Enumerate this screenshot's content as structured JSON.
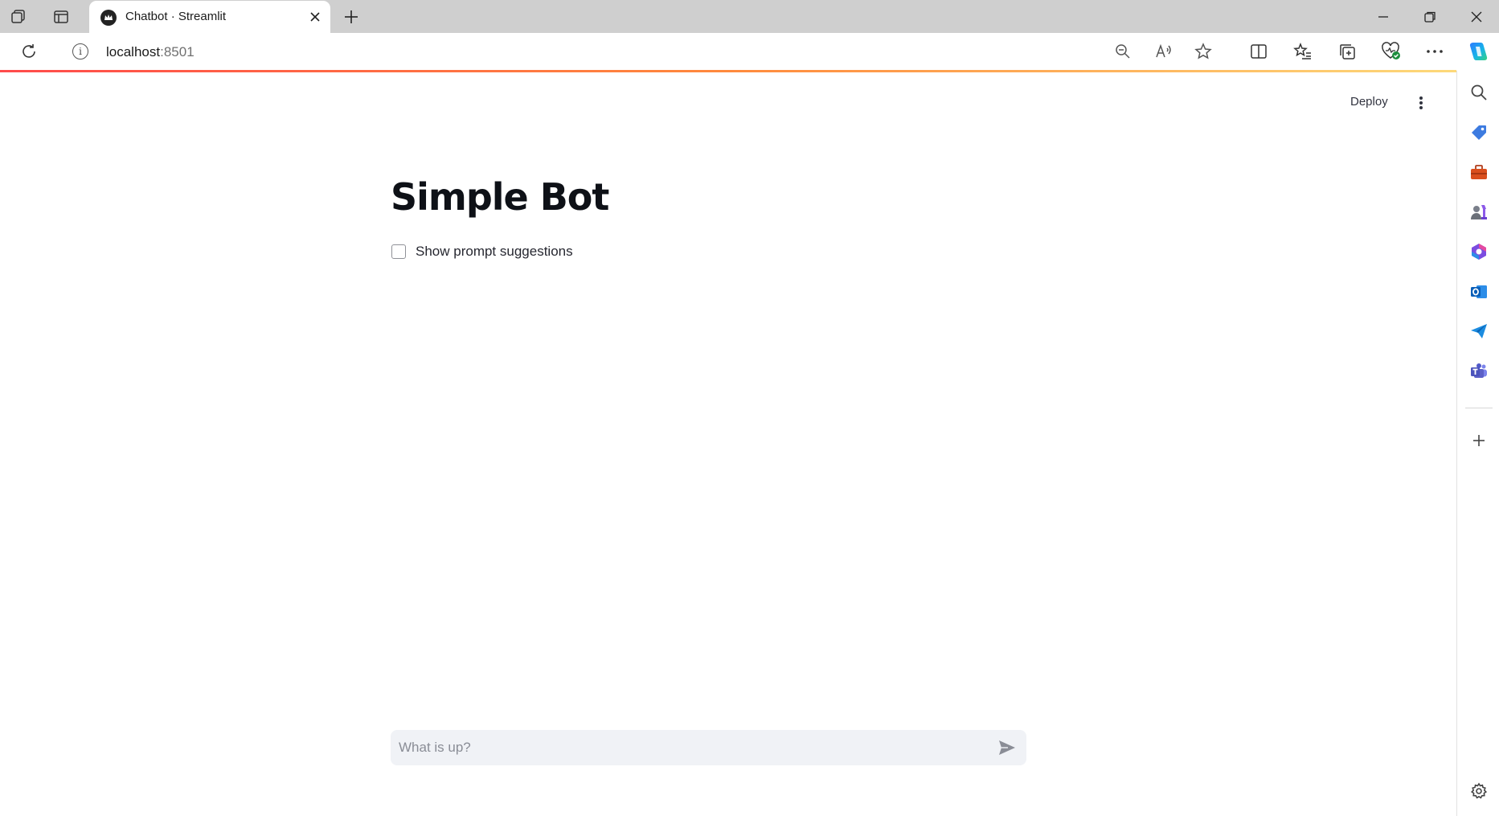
{
  "browser": {
    "tab": {
      "title": "Chatbot · Streamlit"
    },
    "address": {
      "host": "localhost",
      "port": ":8501"
    }
  },
  "app": {
    "header": {
      "deploy_label": "Deploy"
    },
    "title": "Simple Bot",
    "checkbox": {
      "label": "Show prompt suggestions",
      "checked": false
    },
    "chat_input": {
      "placeholder": "What is up?",
      "value": ""
    }
  },
  "colors": {
    "accent": "#ff4b4b",
    "text": "#31333f",
    "input_bg": "#f0f2f6",
    "tabstrip_bg": "#cfcfcf"
  },
  "icons": {
    "tabstrip": [
      "workspaces-icon",
      "vertical-tabs-icon",
      "new-tab-icon"
    ],
    "toolbar": [
      "refresh-icon",
      "info-icon",
      "zoom-out-icon",
      "read-aloud-icon",
      "favorite-star-icon",
      "split-screen-icon",
      "favorites-list-icon",
      "collections-icon",
      "browser-essentials-icon",
      "more-options-icon",
      "copilot-icon"
    ],
    "sidebar": [
      "search-icon",
      "shopping-tag-icon",
      "tools-icon",
      "games-icon",
      "microsoft-365-icon",
      "outlook-icon",
      "send-icon",
      "teams-icon",
      "add-icon",
      "settings-icon"
    ]
  }
}
